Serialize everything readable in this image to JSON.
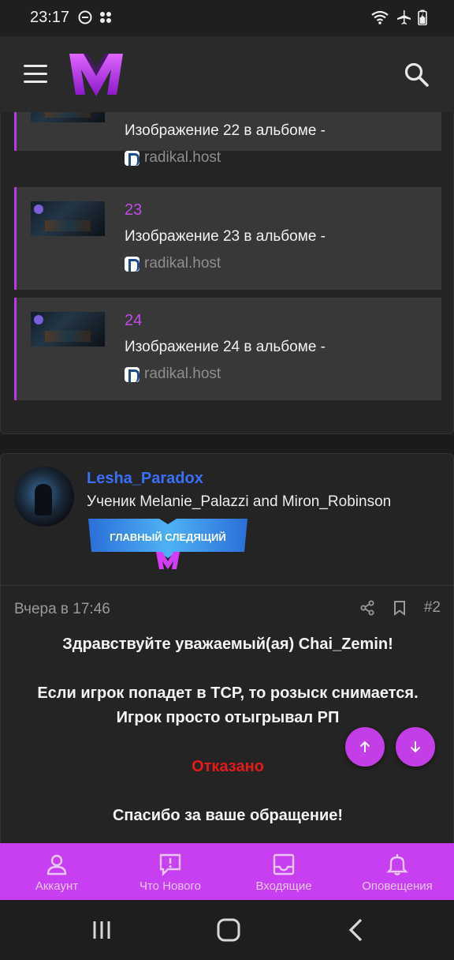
{
  "status_bar": {
    "time": "23:17"
  },
  "embeds": [
    {
      "num": "",
      "title": "Изображение 22 в альбоме -",
      "source": "radikal.host"
    },
    {
      "num": "23",
      "title": "Изображение 23 в альбоме -",
      "source": "radikal.host"
    },
    {
      "num": "24",
      "title": "Изображение 24 в альбоме -",
      "source": "radikal.host"
    }
  ],
  "post": {
    "username": "Lesha_Paradox",
    "user_title": "Ученик Melanie_Palazzi and Miron_Robinson",
    "banner_text": "ГЛАВНЫЙ СЛЕДЯЩИЙ",
    "date": "Вчера в 17:46",
    "post_number": "#2",
    "greeting": "Здравствуйте уважаемый(ая) Chai_Zemin!",
    "body_line1": "Если игрок попадет в ТСР, то розыск снимается.",
    "body_line2": "Игрок просто отыгрывал РП",
    "verdict": "Отказано",
    "thanks": "Спасибо за ваше обращение!"
  },
  "bottom_nav": [
    {
      "label": "Аккаунт",
      "icon": "account-icon"
    },
    {
      "label": "Что Нового",
      "icon": "whats-new-icon"
    },
    {
      "label": "Входящие",
      "icon": "inbox-icon"
    },
    {
      "label": "Оповещения",
      "icon": "bell-icon"
    }
  ],
  "colors": {
    "accent": "#c73ff0",
    "link": "#3a6ff7",
    "denied": "#e51a1a"
  }
}
